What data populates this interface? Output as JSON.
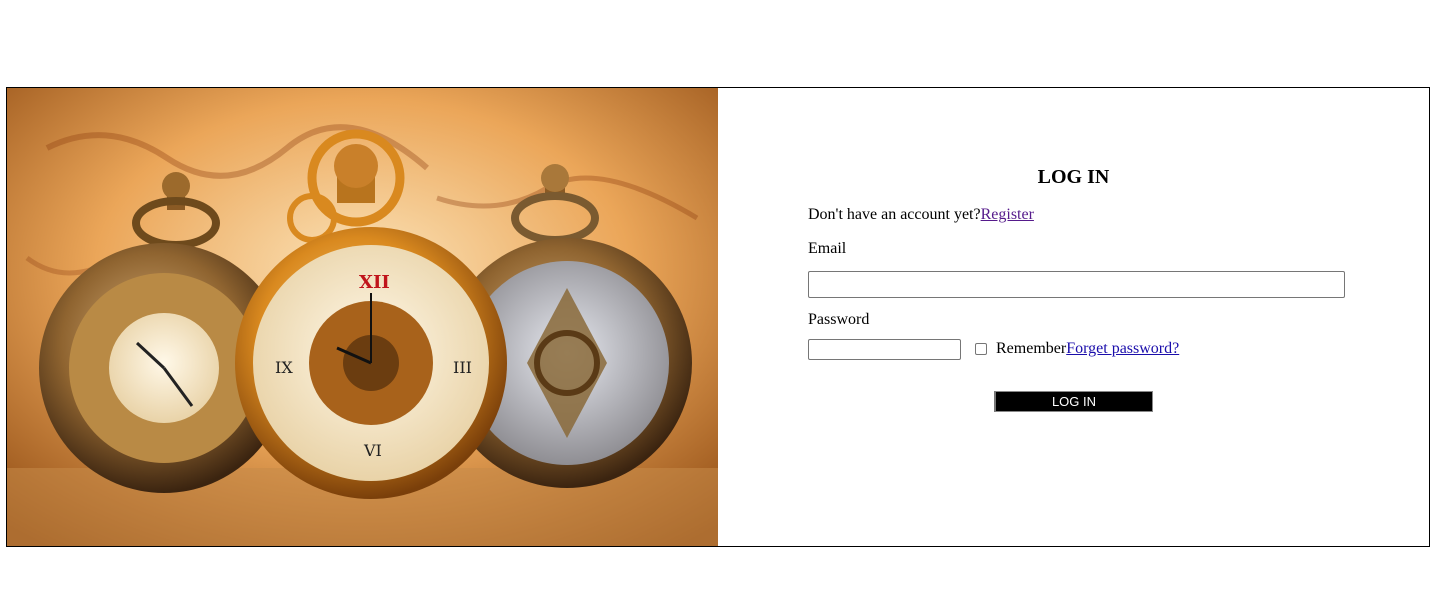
{
  "login": {
    "title": "LOG IN",
    "no_account_text": "Don't have an account yet?",
    "register_link": "Register",
    "email_label": "Email",
    "email_value": "",
    "password_label": "Password",
    "password_value": "",
    "remember_label": "Remember",
    "remember_checked": false,
    "forgot_link": "Forget password?",
    "submit_label": "LOG IN"
  },
  "hero": {
    "image_icon": "pocket-watches-image",
    "colors": {
      "background_warm": "#e9a24a",
      "gold": "#d08a2a",
      "bronze": "#8a5a24"
    }
  }
}
